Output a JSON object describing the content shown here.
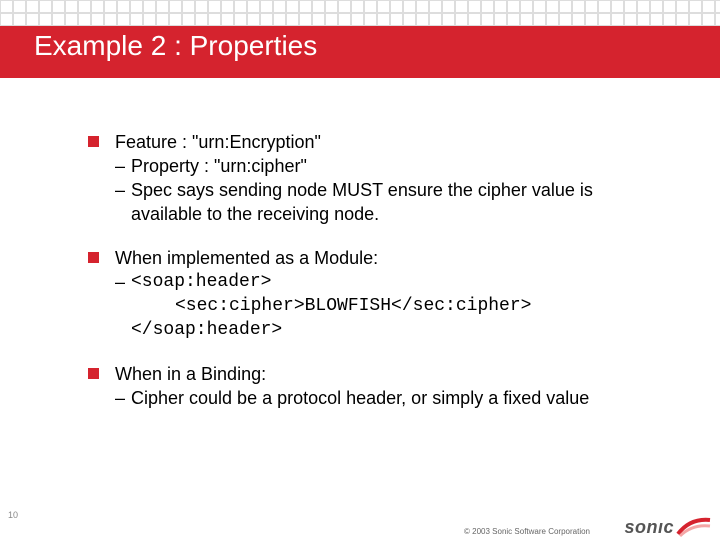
{
  "title": "Example 2 : Properties",
  "bullets": {
    "b1": {
      "head": "Feature : \"urn:Encryption\"",
      "sub1": "Property : \"urn:cipher\"",
      "sub2": "Spec says sending node MUST ensure the cipher value is available to the receiving node."
    },
    "b2": {
      "head": "When implemented as a Module:",
      "code1": "<soap:header>",
      "code2": "  <sec:cipher>BLOWFISH</sec:cipher>",
      "code3": "</soap:header>"
    },
    "b3": {
      "head": "When in a Binding:",
      "sub1": "Cipher could be a protocol header, or simply a fixed value"
    }
  },
  "footer": {
    "page": "10",
    "copyright": "© 2003 Sonic Software Corporation",
    "logo_text": "sonıc"
  }
}
